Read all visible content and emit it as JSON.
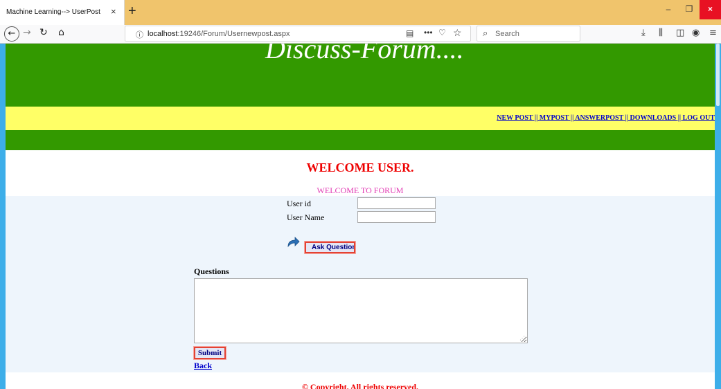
{
  "browser": {
    "tab_title": "Machine Learning--> UserPost",
    "tab_close": "×",
    "new_tab": "+",
    "url_host": "localhost",
    "url_path": ":19246/Forum/Usernewpost.aspx",
    "search_placeholder": "Search",
    "window_controls": {
      "minimize": "–",
      "maximize": "❐",
      "close": "×"
    }
  },
  "site": {
    "title": "Discuss-Forum....",
    "menu": [
      {
        "label": "NEW POST"
      },
      {
        "label": "MYPOST"
      },
      {
        "label": "ANSWERPOST"
      },
      {
        "label": "DOWNLOADS"
      },
      {
        "label": "LOG OUT"
      }
    ],
    "menu_separator": " || "
  },
  "welcome": {
    "heading": "WELCOME USER.",
    "subheading": "WELCOME TO FORUM"
  },
  "form": {
    "user_id_label": "User id",
    "user_id_value": "",
    "user_name_label": "User Name",
    "user_name_value": "",
    "ask_button": "Ask Question",
    "questions_label": "Questions",
    "questions_value": "",
    "submit_button": "Submit",
    "back_link": "Back"
  },
  "footer": {
    "copyright": "© Copyright. All rights reserved."
  },
  "colors": {
    "header_green": "#339900",
    "menu_yellow": "#ffff66",
    "heading_red": "#ee0000",
    "subheading_pink": "#e23cb4",
    "link_blue": "#0000cc"
  }
}
